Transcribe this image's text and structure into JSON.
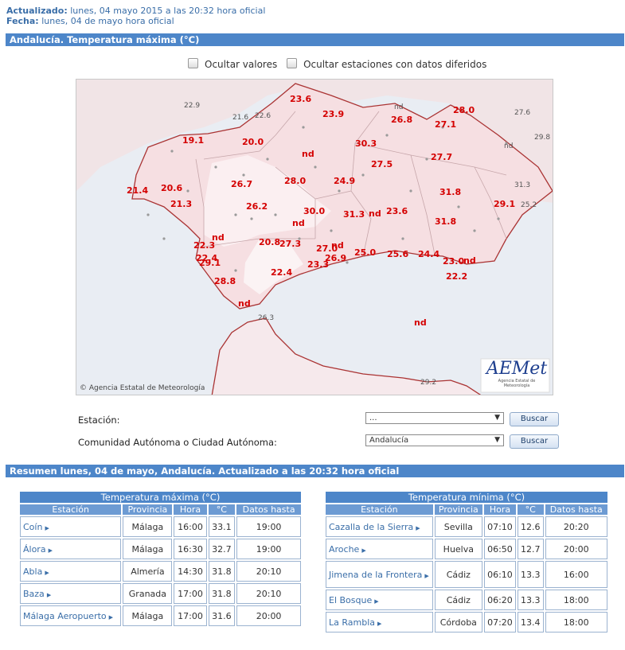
{
  "header": {
    "updated_label": "Actualizado:",
    "updated_value": "lunes, 04 mayo 2015 a las 20:32 hora oficial",
    "date_label": "Fecha:",
    "date_value": "lunes, 04 de mayo hora oficial"
  },
  "section_title": "Andalucía. Temperatura máxima (°C)",
  "options": {
    "hide_values": "Ocultar valores",
    "hide_deferred": "Ocultar estaciones con datos diferidos"
  },
  "map": {
    "copyright": "Agencia Estatal de Meteorología",
    "logo_text": "AEMet",
    "logo_subtext": "Agencia Estatal de Meteorología",
    "labels_red": [
      "23.6",
      "23.9",
      "26.8",
      "28.0",
      "27.1",
      "19.1",
      "20.0",
      "nd",
      "30.3",
      "27.7",
      "27.5",
      "21.4",
      "20.6",
      "26.7",
      "28.0",
      "24.9",
      "31.8",
      "21.3",
      "26.2",
      "30.0",
      "31.3",
      "nd",
      "23.6",
      "29.1",
      "nd",
      "nd",
      "31.8",
      "22.3",
      "20.8",
      "27.3",
      "27.0",
      "nd",
      "25.0",
      "25.6",
      "24.4",
      "nd",
      "22.2",
      "22.4",
      "29.1",
      "26.9",
      "23.3",
      "23.0",
      "28.8",
      "22.4",
      "nd",
      "nd"
    ],
    "labels_gray": [
      "22.9",
      "21.6",
      "22.6",
      "nd",
      "27.6",
      "nd",
      "29.8",
      "31.3",
      "25.2",
      "26.3",
      "29.2"
    ]
  },
  "form": {
    "station_label": "Estación:",
    "station_value": "...",
    "region_label": "Comunidad Autónoma o Ciudad Autónoma:",
    "region_value": "Andalucía",
    "search_button": "Buscar"
  },
  "summary_title": "Resumen lunes, 04 de mayo, Andalucía. Actualizado a las 20:32 hora oficial",
  "max_table": {
    "caption": "Temperatura máxima (°C)",
    "headers": [
      "Estación",
      "Provincia",
      "Hora",
      "°C",
      "Datos hasta"
    ],
    "rows": [
      [
        "Coín",
        "Málaga",
        "16:00",
        "33.1",
        "19:00"
      ],
      [
        "Álora",
        "Málaga",
        "16:30",
        "32.7",
        "19:00"
      ],
      [
        "Abla",
        "Almería",
        "14:30",
        "31.8",
        "20:10"
      ],
      [
        "Baza",
        "Granada",
        "17:00",
        "31.8",
        "20:10"
      ],
      [
        "Málaga Aeropuerto",
        "Málaga",
        "17:00",
        "31.6",
        "20:00"
      ]
    ]
  },
  "min_table": {
    "caption": "Temperatura mínima (°C)",
    "headers": [
      "Estación",
      "Provincia",
      "Hora",
      "°C",
      "Datos hasta"
    ],
    "rows": [
      [
        "Cazalla de la Sierra",
        "Sevilla",
        "07:10",
        "12.6",
        "20:20"
      ],
      [
        "Aroche",
        "Huelva",
        "06:50",
        "12.7",
        "20:00"
      ],
      [
        "Jimena de la Frontera",
        "Cádiz",
        "06:10",
        "13.3",
        "16:00"
      ],
      [
        "El Bosque",
        "Cádiz",
        "06:20",
        "13.3",
        "18:00"
      ],
      [
        "La Rambla",
        "Córdoba",
        "07:20",
        "13.4",
        "18:00"
      ]
    ]
  }
}
